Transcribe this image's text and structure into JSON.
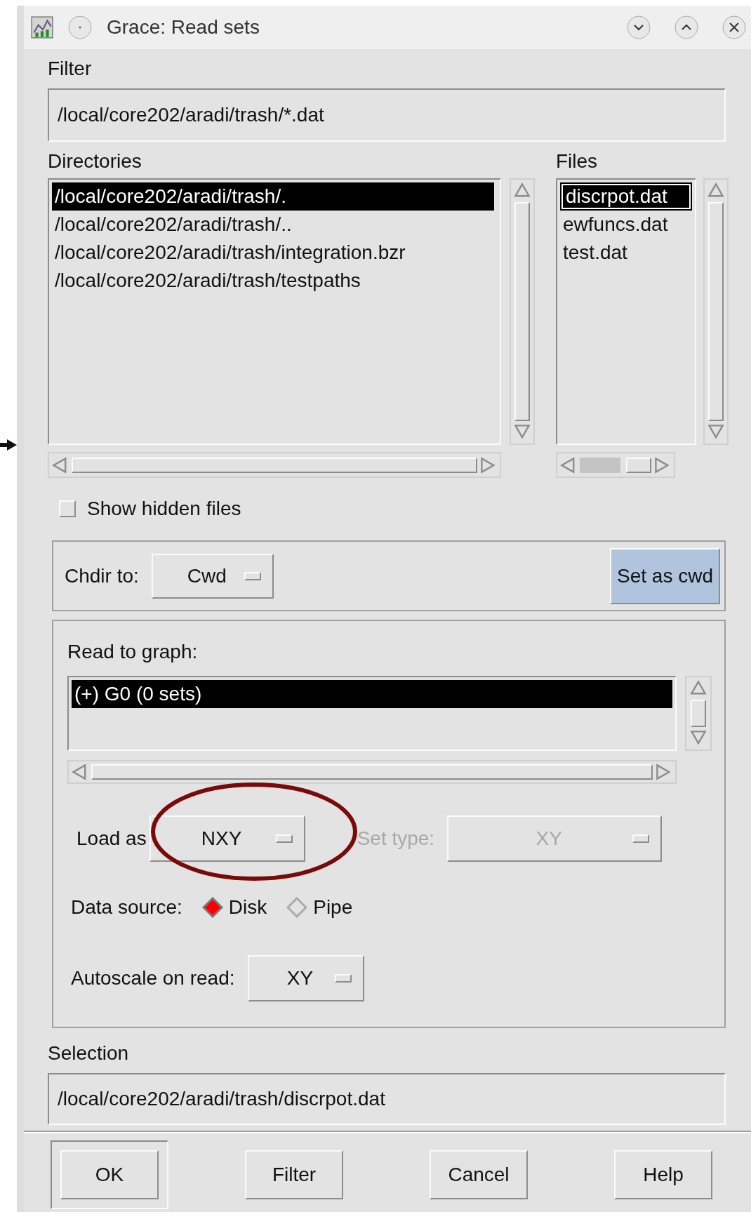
{
  "window": {
    "title": "Grace: Read sets"
  },
  "filter": {
    "label": "Filter",
    "value": "/local/core202/aradi/trash/*.dat"
  },
  "directories": {
    "label": "Directories",
    "items": [
      {
        "label": "/local/core202/aradi/trash/.",
        "selected": true
      },
      {
        "label": "/local/core202/aradi/trash/..",
        "selected": false
      },
      {
        "label": "/local/core202/aradi/trash/integration.bzr",
        "selected": false
      },
      {
        "label": "/local/core202/aradi/trash/testpaths",
        "selected": false
      }
    ]
  },
  "files": {
    "label": "Files",
    "items": [
      {
        "label": "discrpot.dat",
        "selected": true
      },
      {
        "label": "ewfuncs.dat",
        "selected": false
      },
      {
        "label": "test.dat",
        "selected": false
      }
    ]
  },
  "show_hidden": {
    "label": "Show hidden files",
    "checked": false
  },
  "chdir": {
    "label": "Chdir to:",
    "value": "Cwd",
    "button": "Set as cwd"
  },
  "read_to_graph": {
    "label": "Read to graph:",
    "items": [
      {
        "label": "(+) G0 (0 sets)",
        "selected": true
      }
    ]
  },
  "load_as": {
    "label": "Load as",
    "value": "NXY",
    "disabled": false
  },
  "set_type": {
    "label": "Set type:",
    "value": "XY",
    "disabled": true
  },
  "data_source": {
    "label": "Data source:",
    "options": [
      {
        "label": "Disk",
        "selected": true
      },
      {
        "label": "Pipe",
        "selected": false
      }
    ]
  },
  "autoscale": {
    "label": "Autoscale on read:",
    "value": "XY"
  },
  "selection": {
    "label": "Selection",
    "value": "/local/core202/aradi/trash/discrpot.dat"
  },
  "buttons": [
    {
      "label": "OK",
      "default": true
    },
    {
      "label": "Filter",
      "default": false
    },
    {
      "label": "Cancel",
      "default": false
    },
    {
      "label": "Help",
      "default": false
    }
  ]
}
